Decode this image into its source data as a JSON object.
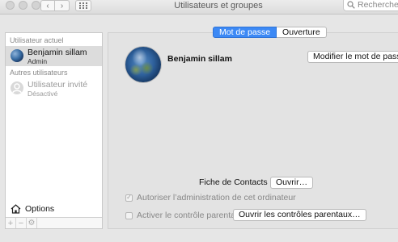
{
  "window": {
    "title": "Utilisateurs et groupes",
    "search_placeholder": "Rechercher"
  },
  "sidebar": {
    "current_user_header": "Utilisateur actuel",
    "current_user": {
      "name": "Benjamin sillam",
      "role": "Admin"
    },
    "other_users_header": "Autres utilisateurs",
    "other_users": [
      {
        "name": "Utilisateur invité",
        "role": "Désactivé"
      }
    ],
    "options_label": "Options",
    "toolbar": {
      "add": "+",
      "remove": "−",
      "settings": "⚙"
    }
  },
  "tabs": [
    {
      "label": "Mot de passe",
      "active": true
    },
    {
      "label": "Ouverture",
      "active": false
    }
  ],
  "main": {
    "username": "Benjamin sillam",
    "change_password_button": "Modifier le mot de passe…",
    "contacts_label": "Fiche de Contacts :",
    "contacts_button": "Ouvrir…",
    "allow_admin_label": "Autoriser l’administration de cet ordinateur",
    "allow_admin_checked": true,
    "parental_label": "Activer le contrôle parental",
    "parental_checked": false,
    "parental_button": "Ouvrir les contrôles parentaux…"
  },
  "colors": {
    "accent": "#3c89f5",
    "selection": "#dcdcdc"
  }
}
